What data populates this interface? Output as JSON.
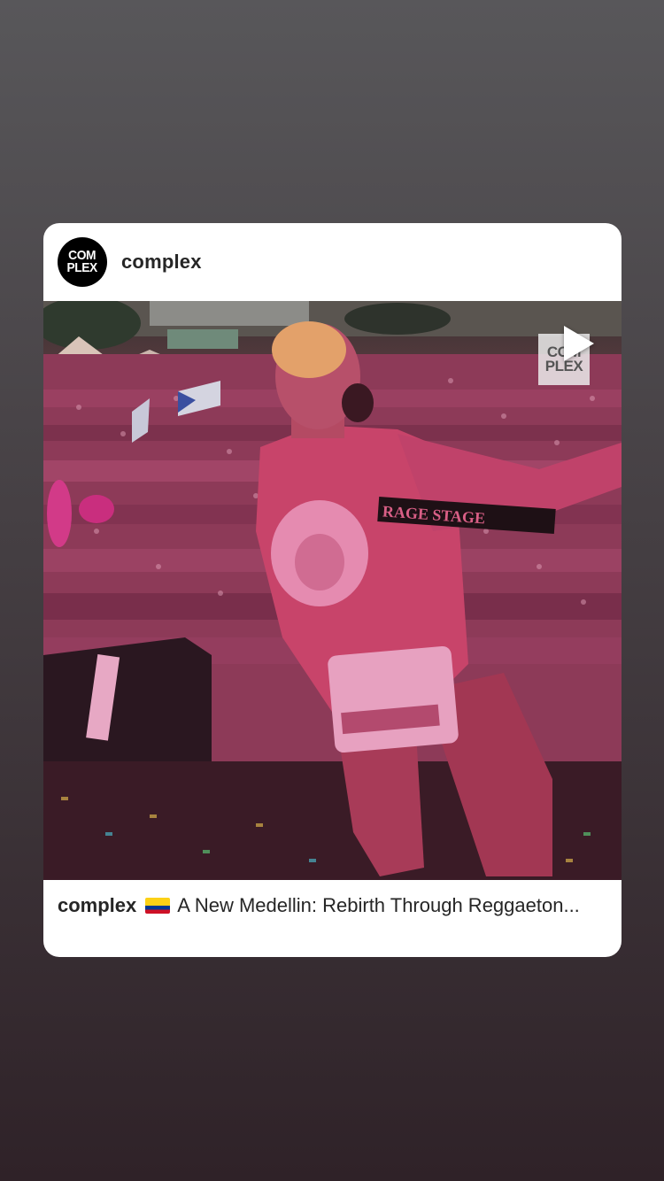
{
  "post": {
    "avatar_text": "COM\nPLEX",
    "username": "complex",
    "caption_user": "complex",
    "caption_text": "A New Medellin: Rebirth Through Reggaeton...",
    "flag_icon": "colombia-flag-icon",
    "media": {
      "watermark_text": "COM\nPLEX",
      "jumpsuit_patch_text": "RAGE STAGE",
      "play_icon": "play-icon"
    }
  },
  "colors": {
    "card_background": "#ffffff",
    "text": "#262626",
    "background_top": "#58575a",
    "background_bottom": "#2f2228",
    "media_tint": "#c8306a"
  }
}
